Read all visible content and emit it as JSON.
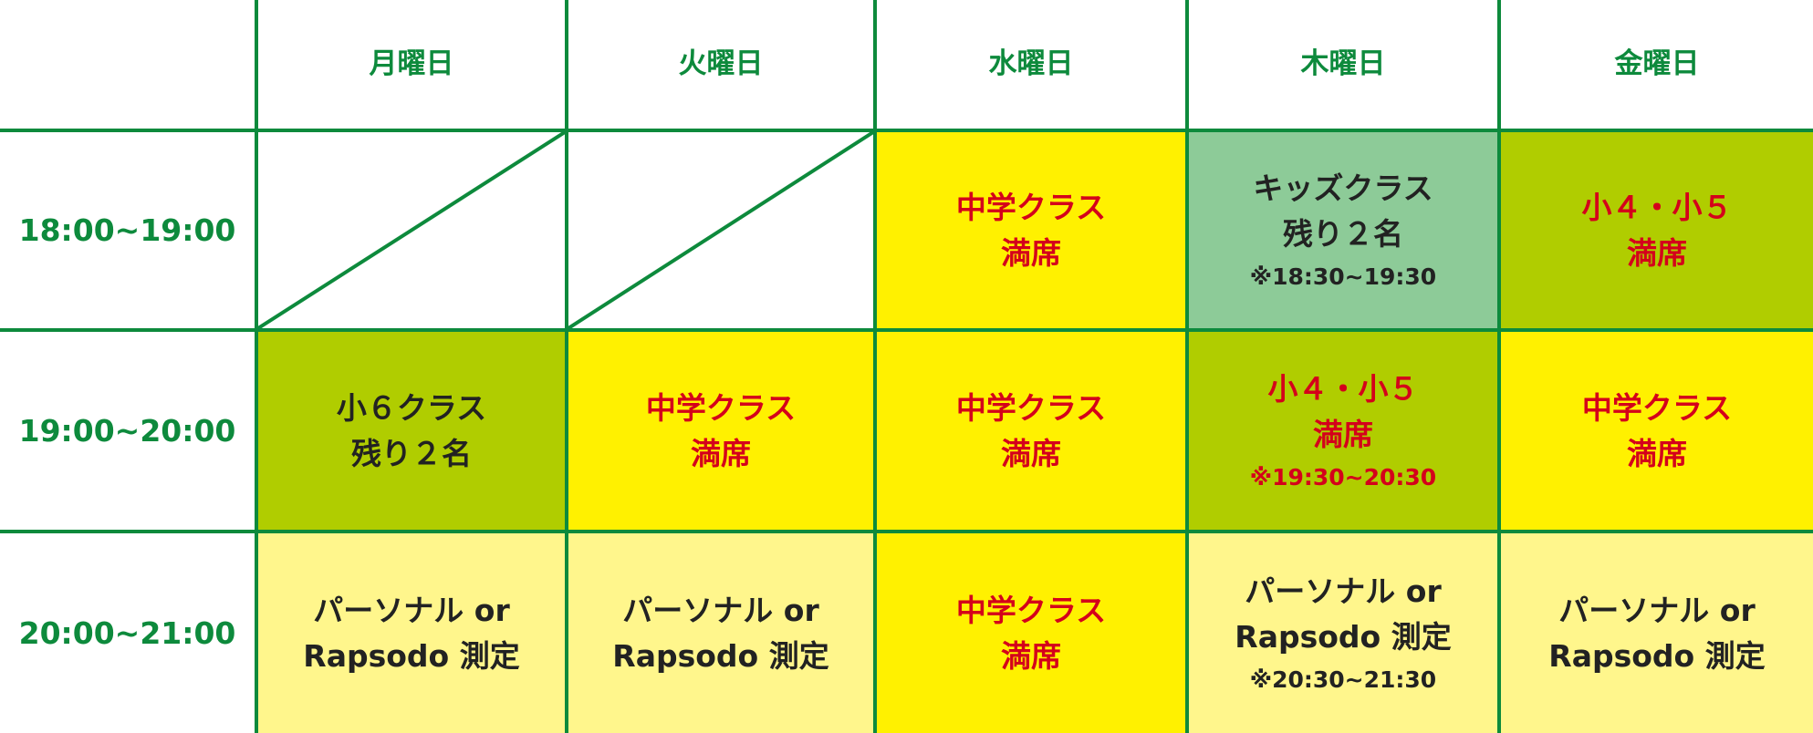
{
  "days": [
    "月曜日",
    "火曜日",
    "水曜日",
    "木曜日",
    "金曜日"
  ],
  "times": [
    "18:00~19:00",
    "19:00~20:00",
    "20:00~21:00"
  ],
  "cells": {
    "r1": {
      "wed": {
        "line1": "中学クラス",
        "line2": "満席"
      },
      "thu": {
        "line1": "キッズクラス",
        "line2": "残り２名",
        "note": "※18:30~19:30"
      },
      "fri": {
        "line1": "小４・小５",
        "line2": "満席"
      }
    },
    "r2": {
      "mon": {
        "line1": "小６クラス",
        "line2": "残り２名"
      },
      "tue": {
        "line1": "中学クラス",
        "line2": "満席"
      },
      "wed": {
        "line1": "中学クラス",
        "line2": "満席"
      },
      "thu": {
        "line1": "小４・小５",
        "line2": "満席",
        "note": "※19:30~20:30"
      },
      "fri": {
        "line1": "中学クラス",
        "line2": "満席"
      }
    },
    "r3": {
      "mon": {
        "line1": "パーソナル or",
        "line2": "Rapsodo 測定"
      },
      "tue": {
        "line1": "パーソナル or",
        "line2": "Rapsodo 測定"
      },
      "wed": {
        "line1": "中学クラス",
        "line2": "満席"
      },
      "thu": {
        "line1": "パーソナル or",
        "line2": "Rapsodo 測定",
        "note": "※20:30~21:30"
      },
      "fri": {
        "line1": "パーソナル or",
        "line2": "Rapsodo 測定"
      }
    }
  },
  "colors": {
    "border": "#0d8a3c",
    "full_text": "#d4001b",
    "yellow": "#fff100",
    "green": "#b0cd00",
    "mint": "#8dcb98",
    "pale": "#fff68c"
  }
}
